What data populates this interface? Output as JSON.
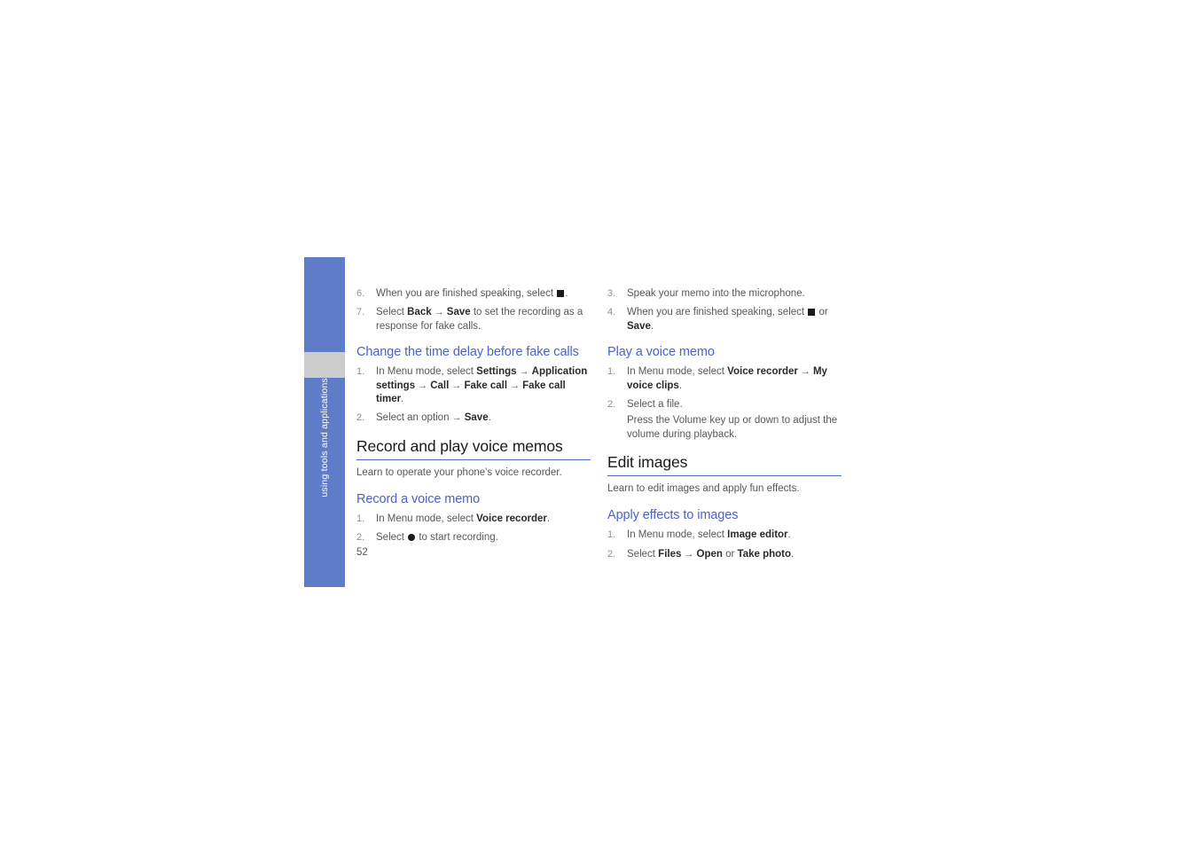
{
  "page": {
    "number": "52",
    "side_tab_label": "using tools and applications",
    "colors": {
      "tab_blue": "#5f7cc8",
      "tab_gray": "#cccccc",
      "heading_blue": "#4a63c4",
      "rule_blue": "#4d68c9",
      "body_gray": "#58585a"
    }
  },
  "left_column": {
    "continued_steps": [
      {
        "num": "6.",
        "parts": [
          {
            "t": "text",
            "v": "When you are finished speaking, select "
          },
          {
            "t": "icon",
            "v": "stop-square-icon"
          },
          {
            "t": "text",
            "v": "."
          }
        ]
      },
      {
        "num": "7.",
        "parts": [
          {
            "t": "text",
            "v": "Select "
          },
          {
            "t": "bold",
            "v": "Back"
          },
          {
            "t": "arrow",
            "v": "→"
          },
          {
            "t": "bold",
            "v": "Save"
          },
          {
            "t": "text",
            "v": " to set the recording as a response for fake calls."
          }
        ]
      }
    ],
    "subsection_1": {
      "heading": "Change the time delay before fake calls",
      "steps": [
        {
          "num": "1.",
          "parts": [
            {
              "t": "text",
              "v": "In Menu mode, select "
            },
            {
              "t": "bold",
              "v": "Settings"
            },
            {
              "t": "arrow",
              "v": "→"
            },
            {
              "t": "bold",
              "v": "Application settings"
            },
            {
              "t": "arrow",
              "v": "→"
            },
            {
              "t": "bold",
              "v": "Call"
            },
            {
              "t": "arrow",
              "v": "→"
            },
            {
              "t": "bold",
              "v": "Fake call"
            },
            {
              "t": "arrow",
              "v": "→"
            },
            {
              "t": "bold",
              "v": "Fake call timer"
            },
            {
              "t": "text",
              "v": "."
            }
          ]
        },
        {
          "num": "2.",
          "parts": [
            {
              "t": "text",
              "v": "Select an option "
            },
            {
              "t": "arrow",
              "v": "→"
            },
            {
              "t": "bold",
              "v": "Save"
            },
            {
              "t": "text",
              "v": "."
            }
          ]
        }
      ]
    },
    "section": {
      "heading": "Record and play voice memos",
      "intro": "Learn to operate your phone's voice recorder.",
      "subsection": {
        "heading": "Record a voice memo",
        "steps": [
          {
            "num": "1.",
            "parts": [
              {
                "t": "text",
                "v": "In Menu mode, select "
              },
              {
                "t": "bold",
                "v": "Voice recorder"
              },
              {
                "t": "text",
                "v": "."
              }
            ]
          },
          {
            "num": "2.",
            "parts": [
              {
                "t": "text",
                "v": "Select "
              },
              {
                "t": "icon",
                "v": "record-circle-icon"
              },
              {
                "t": "text",
                "v": " to start recording."
              }
            ]
          }
        ]
      }
    }
  },
  "right_column": {
    "continued_steps": [
      {
        "num": "3.",
        "parts": [
          {
            "t": "text",
            "v": "Speak your memo into the microphone."
          }
        ]
      },
      {
        "num": "4.",
        "parts": [
          {
            "t": "text",
            "v": "When you are finished speaking, select "
          },
          {
            "t": "icon",
            "v": "stop-square-icon"
          },
          {
            "t": "text",
            "v": " or "
          },
          {
            "t": "bold",
            "v": "Save"
          },
          {
            "t": "text",
            "v": "."
          }
        ]
      }
    ],
    "subsection_1": {
      "heading": "Play a voice memo",
      "steps": [
        {
          "num": "1.",
          "parts": [
            {
              "t": "text",
              "v": "In Menu mode, select "
            },
            {
              "t": "bold",
              "v": "Voice recorder"
            },
            {
              "t": "arrow",
              "v": "→"
            },
            {
              "t": "bold",
              "v": "My voice clips"
            },
            {
              "t": "text",
              "v": "."
            }
          ]
        },
        {
          "num": "2.",
          "parts": [
            {
              "t": "text",
              "v": "Select a file."
            },
            {
              "t": "break",
              "v": ""
            },
            {
              "t": "text",
              "v": "Press the Volume key up or down to adjust the volume during playback."
            }
          ]
        }
      ]
    },
    "section": {
      "heading": "Edit images",
      "intro": "Learn to edit images and apply fun effects.",
      "subsection": {
        "heading": "Apply effects to images",
        "steps": [
          {
            "num": "1.",
            "parts": [
              {
                "t": "text",
                "v": "In Menu mode, select "
              },
              {
                "t": "bold",
                "v": "Image editor"
              },
              {
                "t": "text",
                "v": "."
              }
            ]
          },
          {
            "num": "2.",
            "parts": [
              {
                "t": "text",
                "v": "Select "
              },
              {
                "t": "bold",
                "v": "Files"
              },
              {
                "t": "arrow",
                "v": "→"
              },
              {
                "t": "bold",
                "v": "Open"
              },
              {
                "t": "text",
                "v": " or "
              },
              {
                "t": "bold",
                "v": "Take photo"
              },
              {
                "t": "text",
                "v": "."
              }
            ]
          }
        ]
      }
    }
  }
}
